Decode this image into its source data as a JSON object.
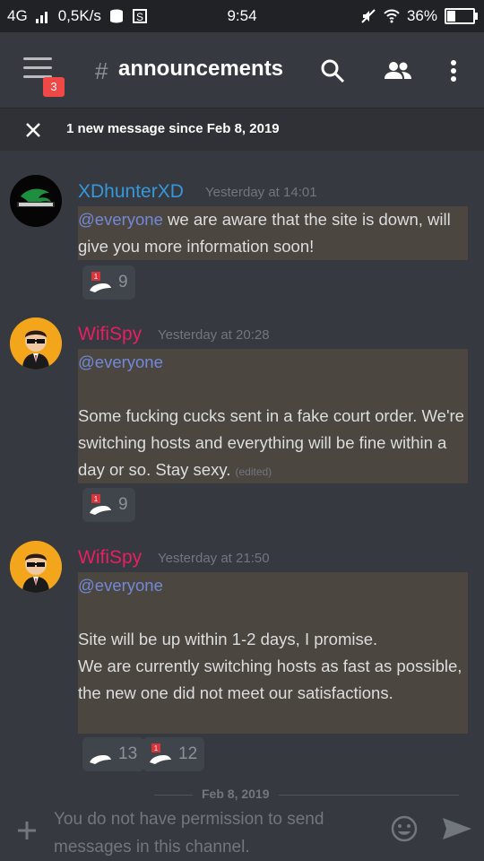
{
  "status_bar": {
    "network": "4G",
    "speed": "0,5K/s",
    "time": "9:54",
    "battery_percent": "36%",
    "battery_level": 0.36
  },
  "header": {
    "hash": "#",
    "channel_name": "announcements",
    "menu_badge": "3",
    "icons": [
      "menu-icon",
      "search-icon",
      "members-icon",
      "more-vertical-icon"
    ]
  },
  "new_message_bar": {
    "text": "1 new message since Feb 8, 2019"
  },
  "messages": [
    {
      "author": "XDhunterXD",
      "author_color": "#3498db",
      "timestamp": "Yesterday at 14:01",
      "mention": "@everyone",
      "text": " we are aware that the site is down, will give you more information soon!",
      "reactions": [
        {
          "emoji": "custom-emoji-1",
          "count": "9"
        }
      ]
    },
    {
      "author": "WifiSpy",
      "author_color": "#e91e63",
      "timestamp": "Yesterday at 20:28",
      "mention": "@everyone",
      "text": "Some fucking cucks sent in a fake court order. We're switching hosts and everything will be fine within a day or so. Stay sexy.",
      "edited": "(edited)",
      "reactions": [
        {
          "emoji": "custom-emoji-1",
          "count": "9"
        }
      ]
    },
    {
      "author": "WifiSpy",
      "author_color": "#e91e63",
      "timestamp": "Yesterday at 21:50",
      "mention": "@everyone",
      "text": "Site will be up within 1-2 days, I promise.\nWe are currently switching hosts as fast as possible, the new one did not meet our satisfactions.",
      "reactions": [
        {
          "emoji": "custom-emoji-2",
          "count": "13"
        },
        {
          "emoji": "custom-emoji-1",
          "count": "12"
        }
      ]
    }
  ],
  "date_divider": "Feb 8, 2019",
  "input_bar": {
    "placeholder": "You do not have permission to send messages in this channel."
  },
  "colors": {
    "background": "#36393f",
    "mention": "#7289da",
    "highlight": "#4b463f"
  }
}
